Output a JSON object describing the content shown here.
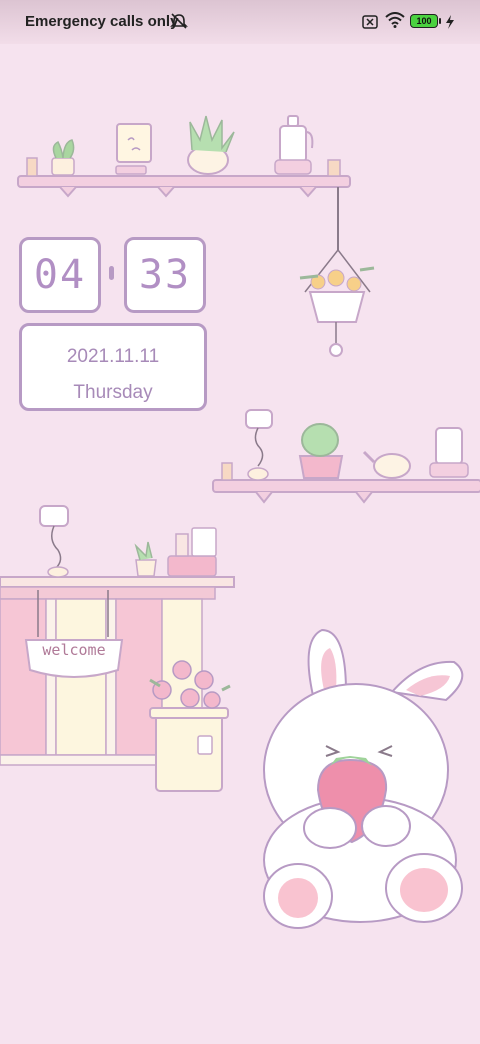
{
  "status_bar": {
    "carrier_text": "Emergency calls only",
    "battery_level": "100",
    "icons": [
      "mute-icon",
      "no-sim-icon",
      "wifi-icon",
      "battery-icon",
      "charging-icon"
    ]
  },
  "clock": {
    "hours": "04",
    "minutes": "33",
    "date": "2021.11.11",
    "weekday": "Thursday"
  },
  "wallpaper": {
    "sign_text": "welcome"
  },
  "colors": {
    "background": "#f6e3ef",
    "accent": "#b79ac4",
    "battery": "#4bd140"
  }
}
